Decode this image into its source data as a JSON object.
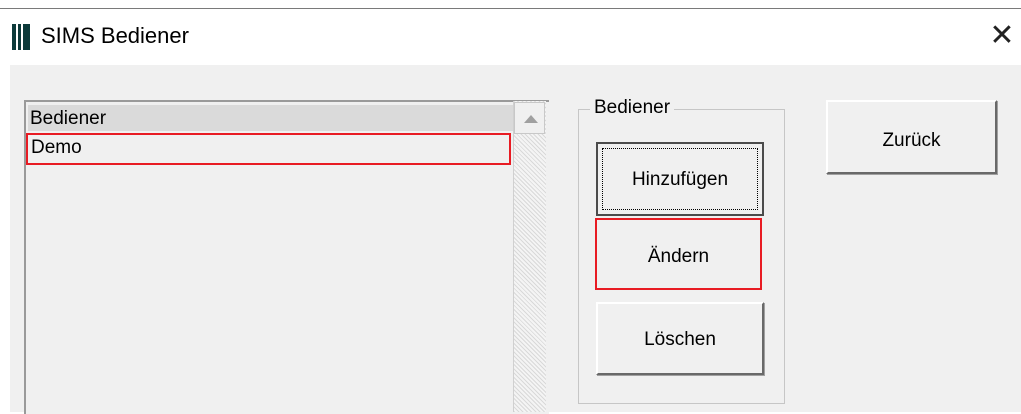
{
  "window": {
    "title": "SIMS Bediener",
    "close_glyph": "✕",
    "icon": "app-icon"
  },
  "list": {
    "header": "Bediener",
    "items": [
      {
        "label": "Demo",
        "highlighted": true
      }
    ]
  },
  "group": {
    "label": "Bediener",
    "buttons": {
      "add_label": "Hinzufügen",
      "edit_label": "Ändern",
      "delete_label": "Löschen"
    }
  },
  "actions": {
    "back_label": "Zurück"
  },
  "colors": {
    "highlight": "#e81b23",
    "dialog_bg": "#f0f0f0",
    "icon": "#0c3a3a"
  }
}
